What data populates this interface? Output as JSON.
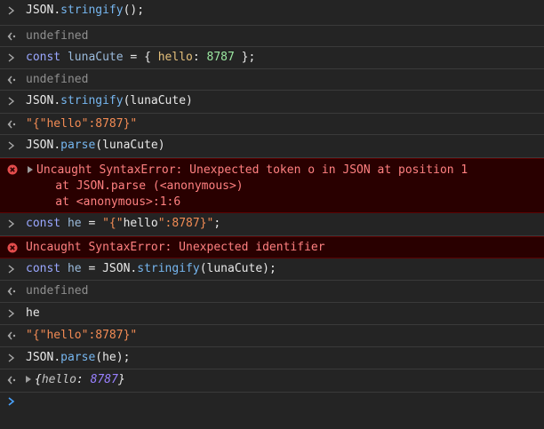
{
  "entries": [
    {
      "kind": "input",
      "tokens": [
        {
          "t": "JSON",
          "c": ""
        },
        {
          "t": ".",
          "c": ""
        },
        {
          "t": "stringify",
          "c": "fn"
        },
        {
          "t": "();",
          "c": ""
        }
      ]
    },
    {
      "kind": "result",
      "text": "undefined"
    },
    {
      "kind": "input",
      "tokens": [
        {
          "t": "const ",
          "c": "k"
        },
        {
          "t": "lunaCute",
          "c": "v"
        },
        {
          "t": " = { ",
          "c": ""
        },
        {
          "t": "hello",
          "c": "p"
        },
        {
          "t": ": ",
          "c": ""
        },
        {
          "t": "8787",
          "c": "n"
        },
        {
          "t": " };",
          "c": ""
        }
      ]
    },
    {
      "kind": "result",
      "text": "undefined"
    },
    {
      "kind": "input",
      "tokens": [
        {
          "t": "JSON",
          "c": ""
        },
        {
          "t": ".",
          "c": ""
        },
        {
          "t": "stringify",
          "c": "fn"
        },
        {
          "t": "(lunaCute)",
          "c": ""
        }
      ]
    },
    {
      "kind": "result-str",
      "text": "\"{\"hello\":8787}\""
    },
    {
      "kind": "input",
      "tokens": [
        {
          "t": "JSON",
          "c": ""
        },
        {
          "t": ".",
          "c": ""
        },
        {
          "t": "parse",
          "c": "fn"
        },
        {
          "t": "(lunaCute)",
          "c": ""
        }
      ]
    },
    {
      "kind": "error",
      "expandable": true,
      "lines": [
        "Uncaught SyntaxError: Unexpected token o in JSON at position 1",
        "    at JSON.parse (<anonymous>)",
        "    at <anonymous>:1:6"
      ]
    },
    {
      "kind": "input",
      "tokens": [
        {
          "t": "const ",
          "c": "k"
        },
        {
          "t": "he",
          "c": "v"
        },
        {
          "t": " = ",
          "c": ""
        },
        {
          "t": "\"{\"",
          "c": "s"
        },
        {
          "t": "hello",
          "c": "sq"
        },
        {
          "t": "\":8787}\"",
          "c": "s"
        },
        {
          "t": ";",
          "c": ""
        }
      ]
    },
    {
      "kind": "error",
      "expandable": false,
      "lines": [
        "Uncaught SyntaxError: Unexpected identifier"
      ]
    },
    {
      "kind": "input",
      "tokens": [
        {
          "t": "const ",
          "c": "k"
        },
        {
          "t": "he",
          "c": "v"
        },
        {
          "t": " = ",
          "c": ""
        },
        {
          "t": "JSON",
          "c": ""
        },
        {
          "t": ".",
          "c": ""
        },
        {
          "t": "stringify",
          "c": "fn"
        },
        {
          "t": "(lunaCute);",
          "c": ""
        }
      ]
    },
    {
      "kind": "result",
      "text": "undefined"
    },
    {
      "kind": "input-plain",
      "tokens": [
        {
          "t": "he",
          "c": ""
        }
      ]
    },
    {
      "kind": "result-str",
      "text": "\"{\"hello\":8787}\""
    },
    {
      "kind": "input",
      "tokens": [
        {
          "t": "JSON",
          "c": ""
        },
        {
          "t": ".",
          "c": ""
        },
        {
          "t": "parse",
          "c": "fn"
        },
        {
          "t": "(he);",
          "c": ""
        }
      ]
    },
    {
      "kind": "result-obj",
      "tokens": [
        {
          "t": "{",
          "c": "obj"
        },
        {
          "t": "hello",
          "c": "objk"
        },
        {
          "t": ": ",
          "c": "obj"
        },
        {
          "t": "8787",
          "c": "objn"
        },
        {
          "t": "}",
          "c": "obj"
        }
      ]
    }
  ],
  "colors": {
    "background": "#242424",
    "error_background": "#290000",
    "error_text": "#ff8080",
    "prompt": "#4aa3ff"
  }
}
